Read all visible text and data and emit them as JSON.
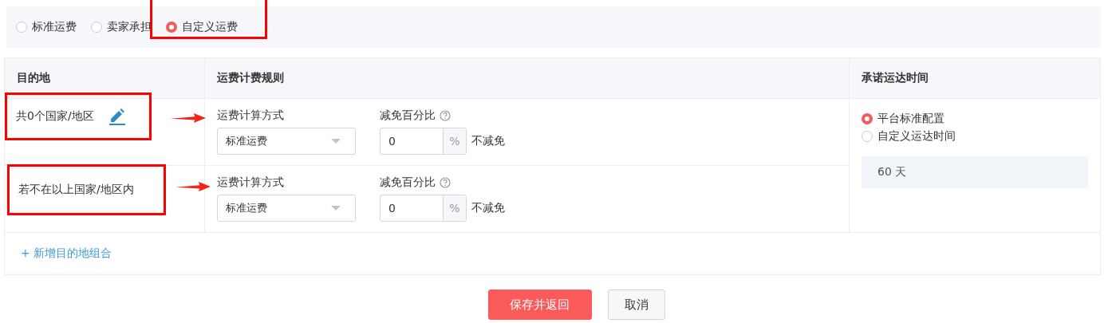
{
  "shipping_options": [
    {
      "label": "标准运费",
      "selected": false,
      "highlighted": false
    },
    {
      "label": "卖家承担",
      "selected": false,
      "highlighted": false
    },
    {
      "label": "自定义运费",
      "selected": true,
      "highlighted": true
    }
  ],
  "table": {
    "columns": [
      "目的地",
      "运费计费规则",
      "承诺运达时间"
    ],
    "rows": [
      {
        "destination": "共0个国家/地区",
        "editable": true,
        "highlighted": true,
        "arrow": true,
        "method_label": "运费计算方式",
        "method": "标准运费",
        "discount_label": "减免百分比",
        "discount": "0",
        "unit": "%",
        "discount_note": "不减免"
      },
      {
        "destination": "若不在以上国家/地区内",
        "editable": false,
        "highlighted": true,
        "arrow": true,
        "method_label": "运费计算方式",
        "method": "标准运费",
        "discount_label": "减免百分比",
        "discount": "0",
        "unit": "%",
        "discount_note": "不减免"
      }
    ],
    "delivery_time": {
      "options": [
        {
          "label": "平台标准配置",
          "selected": true
        },
        {
          "label": "自定义运达时间",
          "selected": false
        }
      ],
      "days": "60 天"
    }
  },
  "add_link": "+ 新增目的地组合",
  "buttons": [
    {
      "label": "保存并返回",
      "kind": "primary"
    },
    {
      "label": "取消",
      "kind": "default"
    }
  ]
}
